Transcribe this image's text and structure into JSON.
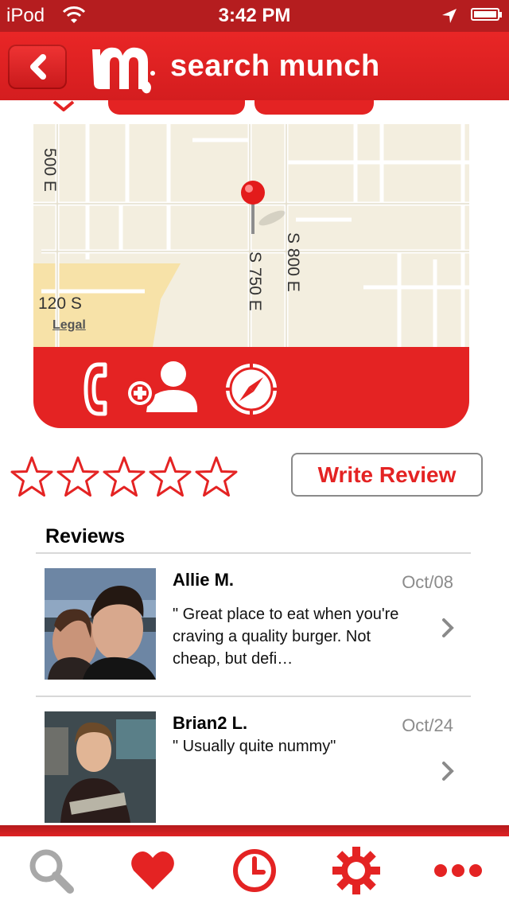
{
  "status_bar": {
    "carrier": "iPod",
    "time": "3:42 PM"
  },
  "nav": {
    "title": "search munch",
    "back_icon": "chevron-left-icon",
    "logo": "m"
  },
  "map": {
    "street_labels": [
      "500 E",
      "120 S",
      "S 750 E",
      "S 800 E"
    ],
    "legal": "Legal",
    "pin_color": "#e31b1b"
  },
  "actions": [
    {
      "icon": "phone-icon"
    },
    {
      "icon": "add-contact-icon"
    },
    {
      "icon": "compass-icon"
    }
  ],
  "rating": {
    "stars_total": 5,
    "stars_filled": 0
  },
  "write_review": "Write Review",
  "reviews": {
    "title": "Reviews",
    "items": [
      {
        "name": "Allie M.",
        "date": "Oct/08",
        "text": "\" Great place to eat when you're craving a quality burger. Not cheap, but defi…"
      },
      {
        "name": "Brian2 L.",
        "date": "Oct/24",
        "text": "\" Usually quite nummy\""
      }
    ]
  },
  "tabbar": [
    {
      "icon": "search-icon",
      "active": false
    },
    {
      "icon": "heart-icon",
      "active": true
    },
    {
      "icon": "clock-icon",
      "active": true
    },
    {
      "icon": "gear-icon",
      "active": true
    },
    {
      "icon": "more-icon",
      "active": true
    }
  ],
  "colors": {
    "brand_red": "#e42323",
    "dark_red": "#b51d1f",
    "inactive_gray": "#a8a8a8"
  }
}
